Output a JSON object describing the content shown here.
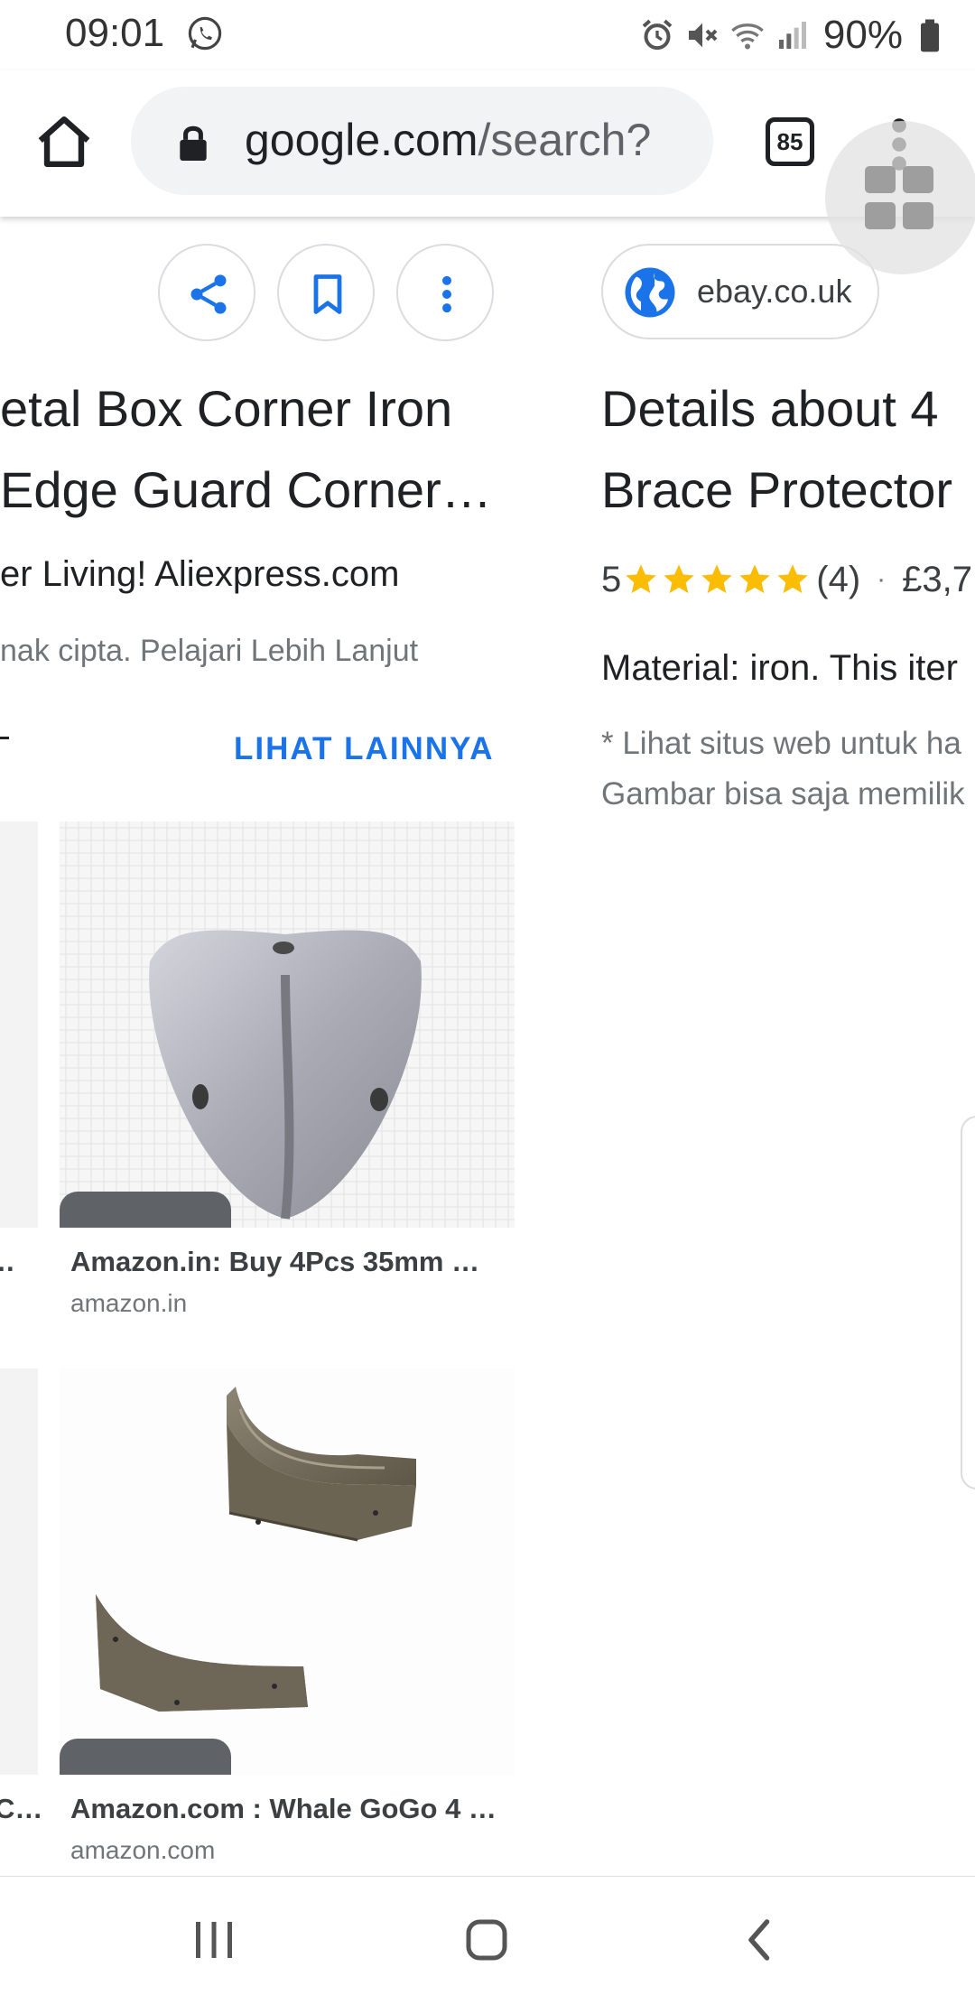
{
  "status_bar": {
    "time": "09:01",
    "battery": "90%",
    "icons": [
      "whatsapp-icon",
      "alarm-icon",
      "mute-icon",
      "wifi-icon",
      "signal-icon",
      "battery-icon"
    ]
  },
  "browser": {
    "url_domain": "google.com",
    "url_path": "/search?",
    "tab_count": "85"
  },
  "left_card": {
    "title_line1": "etal Box Corner Iron",
    "title_line2": "Edge Guard Corner…",
    "source": "er Living! Aliexpress.com",
    "copyright": "nak cipta. Pelajari Lebih Lanjut",
    "more_label": "LIHAT LAINNYA",
    "related": [
      {
        "title": "Amazon.in: Buy 4Pcs 35mm …",
        "domain": "amazon.in",
        "left_stub": "…"
      },
      {
        "title": "Amazon.com : Whale GoGo 4 …",
        "domain": "amazon.com",
        "left_stub": "C…"
      }
    ]
  },
  "right_card": {
    "source": "ebay.co.uk",
    "title_line1": "Details about 4",
    "title_line2": "Brace Protector",
    "rating_value": "5",
    "stars": 5,
    "review_count": "(4)",
    "separator": "·",
    "price": "£3,7",
    "description": "Material: iron. This iter",
    "note_line1": "* Lihat situs web untuk ha",
    "note_line2": "Gambar bisa saja memilik"
  },
  "colors": {
    "accent_blue": "#1a73e8",
    "star_yellow": "#fbbc04",
    "text_primary": "#202124",
    "text_secondary": "#70757a"
  }
}
